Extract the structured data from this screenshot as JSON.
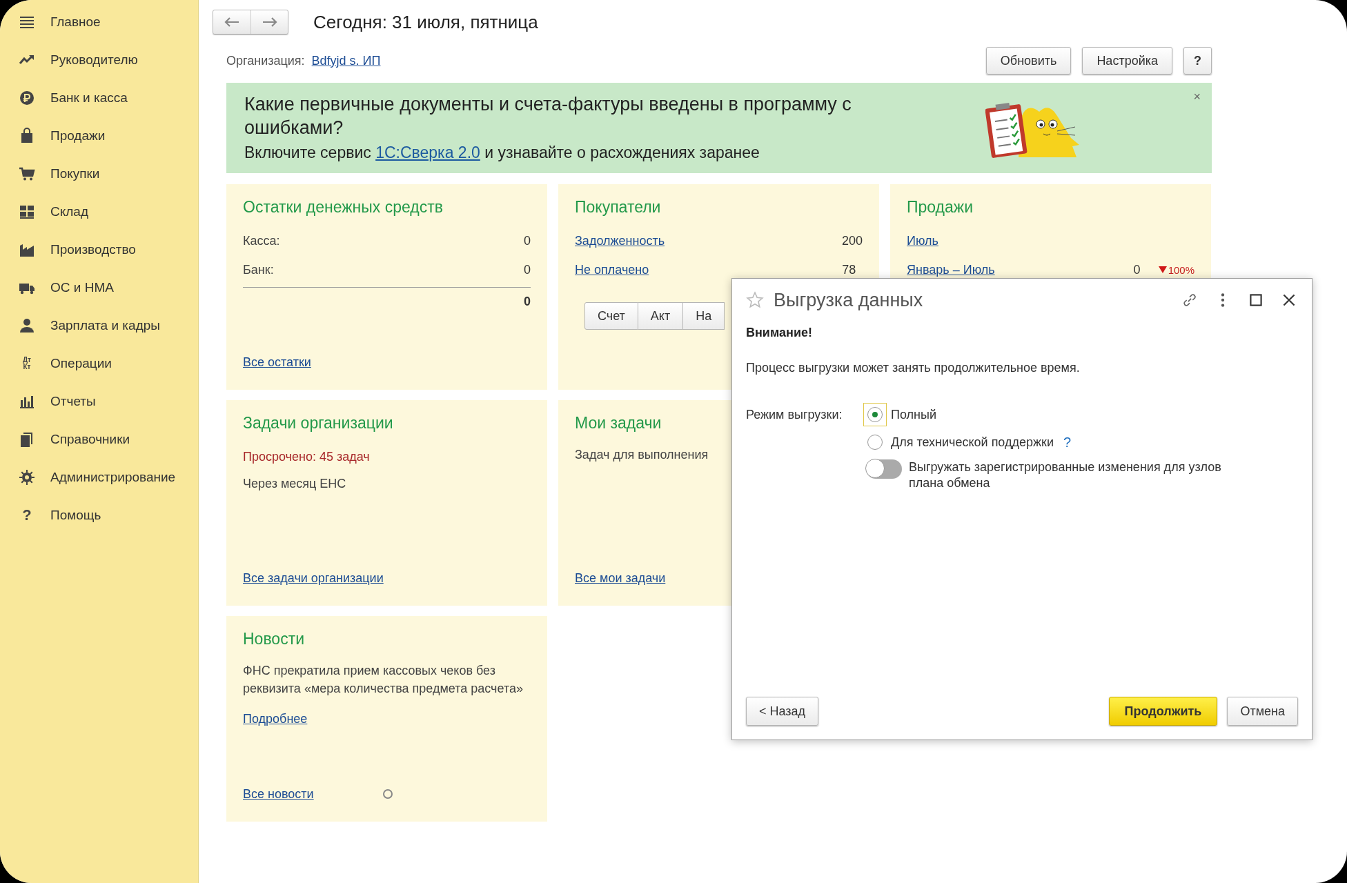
{
  "sidebar": {
    "items": [
      {
        "label": "Главное"
      },
      {
        "label": "Руководителю"
      },
      {
        "label": "Банк и касса"
      },
      {
        "label": "Продажи"
      },
      {
        "label": "Покупки"
      },
      {
        "label": "Склад"
      },
      {
        "label": "Производство"
      },
      {
        "label": "ОС и НМА"
      },
      {
        "label": "Зарплата и кадры"
      },
      {
        "label": "Операции",
        "icon_text": [
          "Дт",
          "Кт"
        ]
      },
      {
        "label": "Отчеты"
      },
      {
        "label": "Справочники"
      },
      {
        "label": "Администрирование"
      },
      {
        "label": "Помощь",
        "icon_text": [
          "?"
        ]
      }
    ]
  },
  "header": {
    "title": "Сегодня: 31 июля, пятница",
    "org_label": "Организация:",
    "org_value": "Bdfyjd s. ИП",
    "buttons": [
      "Обновить",
      "Настройка",
      "?"
    ]
  },
  "banner": {
    "title": "Какие первичные документы и счета-фактуры введены в программу с ошибками?",
    "text_before": "Включите сервис ",
    "link": "1С:Сверка 2.0",
    "text_after": " и узнавайте о расхождениях заранее",
    "close": "×"
  },
  "cards": [
    {
      "title": "Остатки денежных средств",
      "lines": [
        {
          "kind": "pair",
          "label": "Касса:",
          "value": "0"
        },
        {
          "kind": "pair",
          "label": "Банк:",
          "value": "0"
        },
        {
          "kind": "total",
          "value": "0"
        },
        {
          "kind": "footer_link",
          "label": "Все остатки"
        }
      ]
    },
    {
      "title": "Покупатели",
      "lines": [
        {
          "kind": "link_pair",
          "label": "Задолженность",
          "value": "200"
        },
        {
          "kind": "link_pair",
          "label": "Не оплачено",
          "value": "78"
        },
        {
          "kind": "buttons",
          "labels": [
            "Счет",
            "Акт",
            "На"
          ]
        }
      ]
    },
    {
      "title": "Продажи",
      "lines": [
        {
          "kind": "link",
          "label": "Июль"
        },
        {
          "kind": "change_pair",
          "label": "Январь – Июль",
          "value": "0",
          "change": "100%"
        }
      ]
    },
    {
      "title": "Задачи организации",
      "lines": [
        {
          "kind": "alert",
          "label": "Просрочено: 45 задач"
        },
        {
          "kind": "text",
          "label": "Через месяц ЕНС"
        },
        {
          "kind": "footer_link",
          "label": "Все задачи организации"
        }
      ]
    },
    {
      "title": "Мои задачи",
      "lines": [
        {
          "kind": "text",
          "label": "Задач для выполнения"
        },
        {
          "kind": "footer_link",
          "label": "Все мои задачи"
        }
      ]
    },
    {
      "title": "Новости",
      "lines": [
        {
          "kind": "text",
          "label": "ФНС прекратила прием кассовых чеков без реквизита «мера количества предмета расчета»"
        },
        {
          "kind": "link",
          "label": "Подробнее"
        },
        {
          "kind": "footer_link_loading",
          "label": "Все новости"
        }
      ]
    }
  ],
  "dialog": {
    "title": "Выгрузка данных",
    "heading": "Внимание!",
    "text": "Процесс выгрузки может занять продолжительное время.",
    "mode_label": "Режим выгрузки:",
    "options": [
      {
        "label": "Полный",
        "selected": true
      },
      {
        "label": "Для технической поддержки",
        "selected": false,
        "help": "?"
      }
    ],
    "toggle": {
      "label": "Выгружать зарегистрированные изменения для узлов плана обмена",
      "on": false
    },
    "buttons": [
      {
        "label": "< Назад",
        "kind": "back"
      },
      {
        "label": "Продолжить",
        "kind": "primary"
      },
      {
        "label": "Отмена",
        "kind": "cancel"
      }
    ]
  }
}
